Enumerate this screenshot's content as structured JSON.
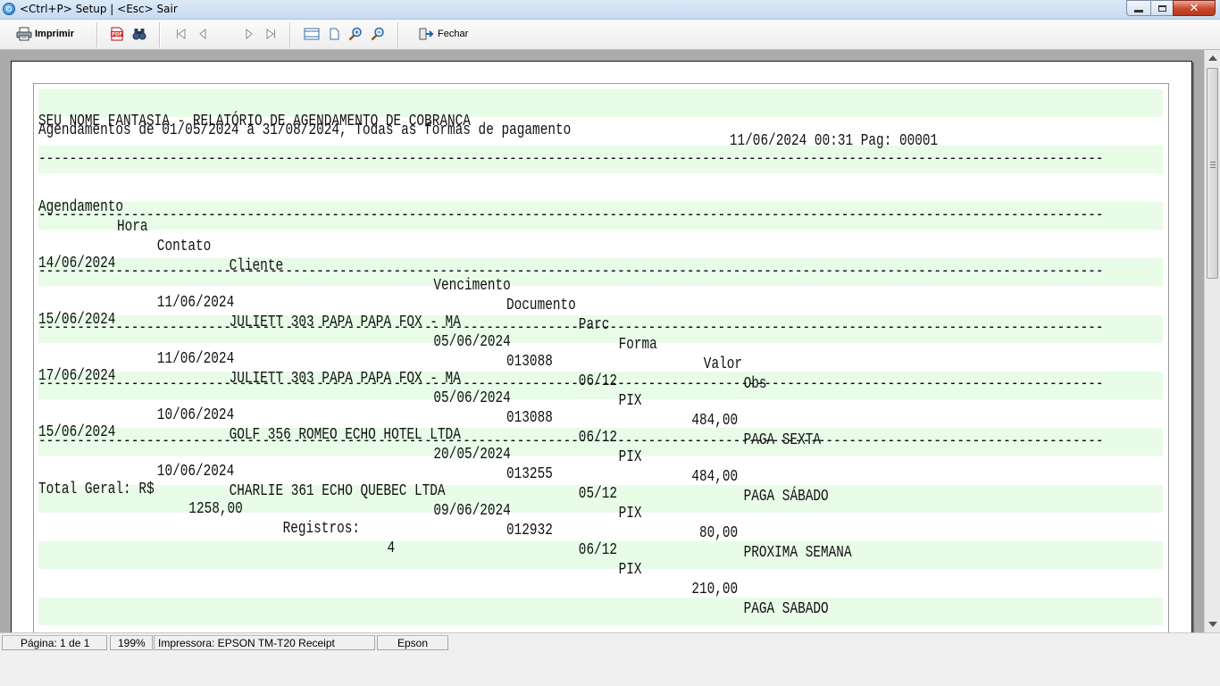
{
  "window": {
    "title": "<Ctrl+P> Setup | <Esc> Sair",
    "close_glyph": "✕"
  },
  "toolbar": {
    "print_label": "Imprimir",
    "close_label": "Fechar",
    "pdf_icon_text": "PDF"
  },
  "report": {
    "header_title": "SEU NOME FANTASIA - RELATÓRIO DE AGENDAMENTO DE COBRANCA",
    "header_datetime": "11/06/2024 00:31 Pag: 00001",
    "subtitle": "Agendamentos de 01/05/2024 a 31/08/2024, Todas as formas de pagamento",
    "separator": "------------------------------------------------------------------------------------------------------------------------------------------",
    "columns": {
      "agendamento": "Agendamento",
      "hora": "Hora",
      "contato": "Contato",
      "cliente": "Cliente",
      "vencimento": "Vencimento",
      "documento": "Documento",
      "parc": "Parc",
      "forma": "Forma",
      "valor": "Valor",
      "obs": "Obs"
    },
    "rows": [
      {
        "agendamento": "14/06/2024",
        "hora": "",
        "contato": "11/06/2024",
        "cliente": "JULIETT 303 PAPA PAPA FOX - MA",
        "vencimento": "05/06/2024",
        "documento": "013088",
        "parc": "06/12",
        "forma": "PIX",
        "valor": "484,00",
        "obs": "PAGA SEXTA"
      },
      {
        "agendamento": "15/06/2024",
        "hora": "",
        "contato": "11/06/2024",
        "cliente": "JULIETT 303 PAPA PAPA FOX - MA",
        "vencimento": "05/06/2024",
        "documento": "013088",
        "parc": "06/12",
        "forma": "PIX",
        "valor": "484,00",
        "obs": "PAGA SÁBADO"
      },
      {
        "agendamento": "17/06/2024",
        "hora": "",
        "contato": "10/06/2024",
        "cliente": "GOLF 356 ROMEO ECHO HOTEL LTDA",
        "vencimento": "20/05/2024",
        "documento": "013255",
        "parc": "05/12",
        "forma": "PIX",
        "valor": "80,00",
        "obs": "PROXIMA SEMANA"
      },
      {
        "agendamento": "15/06/2024",
        "hora": "",
        "contato": "10/06/2024",
        "cliente": "CHARLIE 361 ECHO QUEBEC LTDA",
        "vencimento": "09/06/2024",
        "documento": "012932",
        "parc": "06/12",
        "forma": "PIX",
        "valor": "210,00",
        "obs": "PAGA SABADO"
      }
    ],
    "total_label": "Total Geral: R$",
    "total_value": "1258,00",
    "records_label": "Registros:",
    "records_value": "4"
  },
  "statusbar": {
    "page": "Página: 1 de 1",
    "zoom": "199%",
    "printer": "Impressora: EPSON TM-T20 Receipt",
    "printer_brand": "Epson"
  }
}
